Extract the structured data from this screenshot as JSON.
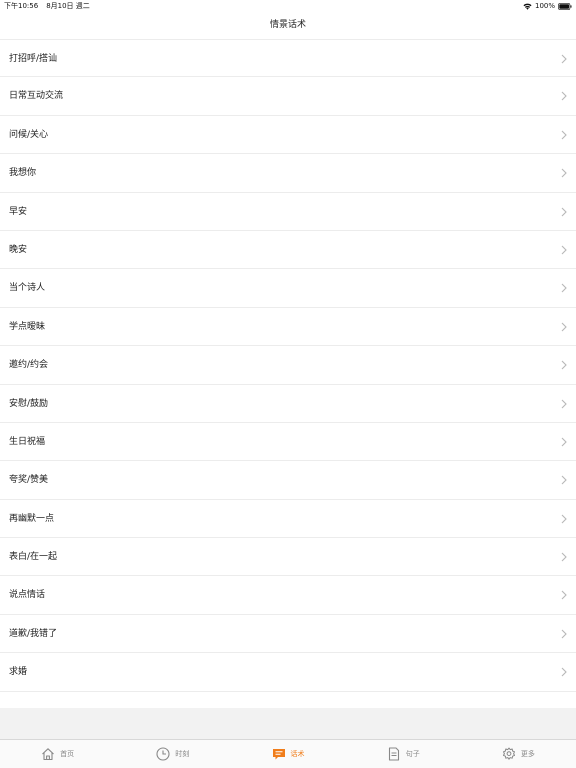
{
  "status_bar": {
    "time": "下午10:56",
    "date": "8月10日 週二",
    "battery": "100%"
  },
  "header": {
    "title": "情景话术"
  },
  "list": {
    "items": [
      {
        "label": "打招呼/搭讪"
      },
      {
        "label": "日常互动交流"
      },
      {
        "label": "问候/关心"
      },
      {
        "label": "我想你"
      },
      {
        "label": "早安"
      },
      {
        "label": "晚安"
      },
      {
        "label": "当个诗人"
      },
      {
        "label": "学点暧昧"
      },
      {
        "label": "邀约/约会"
      },
      {
        "label": "安慰/鼓励"
      },
      {
        "label": "生日祝福"
      },
      {
        "label": "夸奖/赞美"
      },
      {
        "label": "再幽默一点"
      },
      {
        "label": "表白/在一起"
      },
      {
        "label": "说点情话"
      },
      {
        "label": "道歉/我错了"
      },
      {
        "label": "求婚"
      }
    ]
  },
  "tab_bar": {
    "tabs": [
      {
        "label": "首页",
        "icon": "home-icon",
        "active": false
      },
      {
        "label": "时刻",
        "icon": "clock-icon",
        "active": false
      },
      {
        "label": "话术",
        "icon": "chat-icon",
        "active": true
      },
      {
        "label": "句子",
        "icon": "document-icon",
        "active": false
      },
      {
        "label": "更多",
        "icon": "gear-icon",
        "active": false
      }
    ]
  },
  "colors": {
    "accent": "#f07d1a",
    "inactive": "#888888",
    "separator": "#ececec",
    "background_fill": "#f2f2f2"
  }
}
